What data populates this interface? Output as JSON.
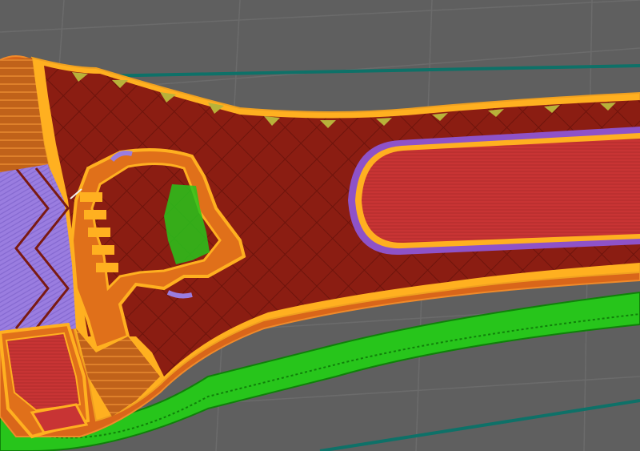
{
  "viewport": {
    "kind": "3d-slicer-preview",
    "background_color": "#5f5f5f",
    "grid_line_color": "#6b6b6b"
  },
  "colors": {
    "bed_edge": "#0e7168",
    "skirt": "#27c51b",
    "skirt_dark": "#10800a",
    "outer_wall": "#e0701a",
    "perimeter": "#ffb020",
    "inner_perimeter": "#d8a030",
    "solid_infill": "#c83434",
    "sparse_infill": "#8b1d12",
    "infill_grid": "#6e140c",
    "overhang": "#9a7de0",
    "gap_fill": "#b8b23a",
    "bridge": "#8e52c8"
  },
  "legend_icons": [
    "skirt-icon",
    "outer-wall-icon",
    "perimeter-icon",
    "solid-infill-icon",
    "sparse-infill-icon",
    "overhang-icon",
    "gap-fill-icon"
  ]
}
